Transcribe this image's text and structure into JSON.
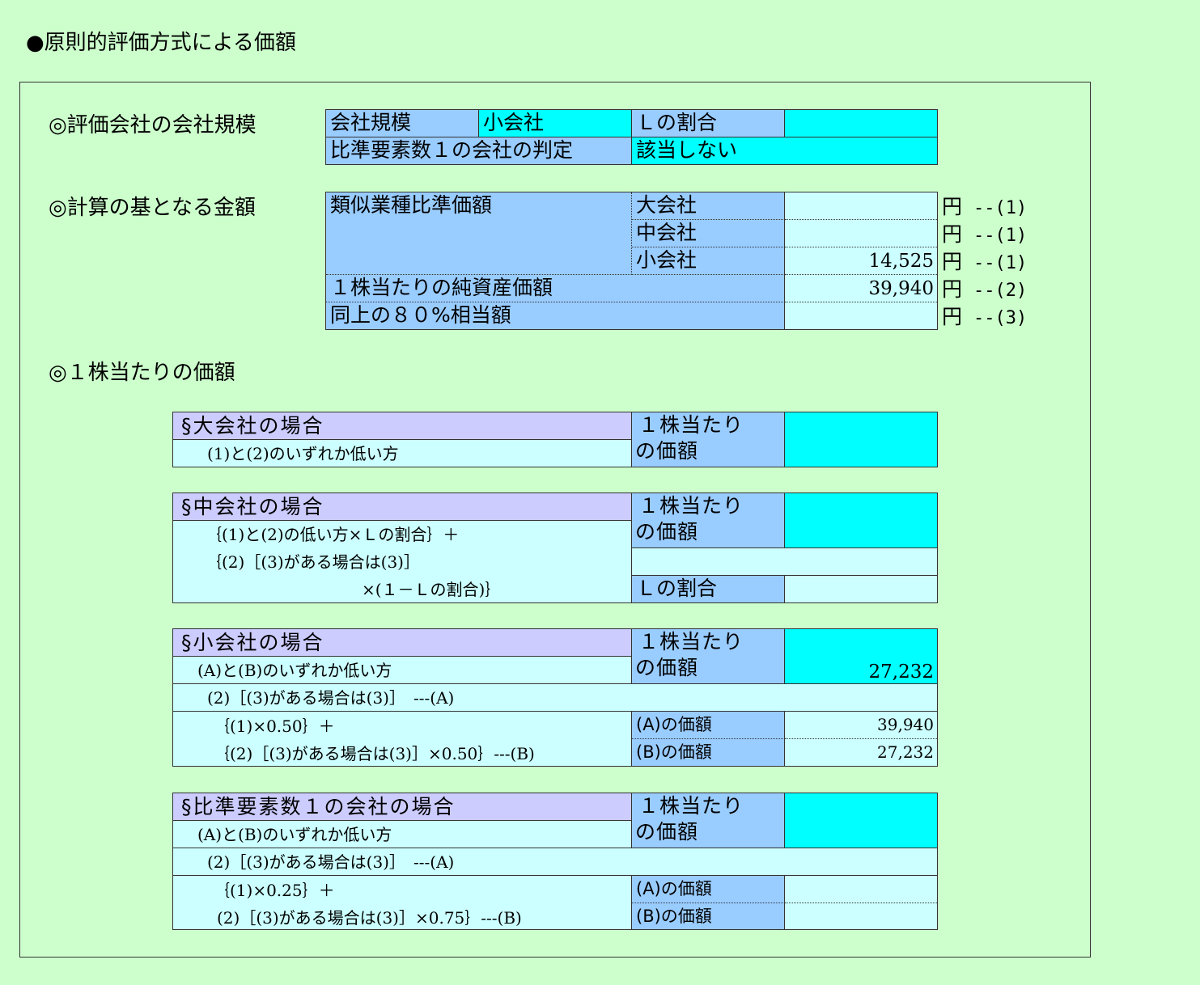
{
  "page_title": "●原則的評価方式による価額",
  "size_section": {
    "heading": "◎評価会社の会社規模",
    "size_label": "会社規模",
    "size_value": "小会社",
    "l_ratio_label": "Ｌの割合",
    "l_ratio_value": "",
    "ratio1_label": "比準要素数１の会社の判定",
    "ratio1_value": "該当しない"
  },
  "base_section": {
    "heading": "◎計算の基となる金額",
    "similar_label": "類似業種比準価額",
    "rows": [
      {
        "label": "大会社",
        "value": "",
        "unit": "円",
        "ref": "--(1)"
      },
      {
        "label": "中会社",
        "value": "",
        "unit": "円",
        "ref": "--(1)"
      },
      {
        "label": "小会社",
        "value": "14,525",
        "unit": "円",
        "ref": "--(1)"
      }
    ],
    "net_asset_label": "１株当たりの純資産価額",
    "net_asset_value": "39,940",
    "net_asset_unit": "円",
    "net_asset_ref": "--(2)",
    "eighty_label": "同上の８０%相当額",
    "eighty_value": "",
    "eighty_unit": "円",
    "eighty_ref": "--(3)"
  },
  "per_share_section": {
    "heading": "◎１株当たりの価額",
    "large": {
      "title": "§大会社の場合",
      "formula": "(1)と(2)のいずれか低い方",
      "price_label_1": "１株当たり",
      "price_label_2": "の価額",
      "price_value": ""
    },
    "medium": {
      "title": "§中会社の場合",
      "formula_1": "｛(1)と(2)の低い方×Ｌの割合｝＋",
      "formula_2": "｛(2)［(3)がある場合は(3)］",
      "formula_3": "×(１－Ｌの割合)｝",
      "price_label_1": "１株当たり",
      "price_label_2": "の価額",
      "price_value": "",
      "l_ratio_label": "Ｌの割合",
      "l_ratio_value": ""
    },
    "small": {
      "title": "§小会社の場合",
      "formula_main": "(A)と(B)のいずれか低い方",
      "formula_1": "(2)［(3)がある場合は(3)］　---(A)",
      "formula_2": "｛(1)×0.50｝＋",
      "formula_3": "｛(2)［(3)がある場合は(3)］×0.50｝---(B)",
      "price_label_1": "１株当たり",
      "price_label_2": "の価額",
      "price_value": "27,232",
      "a_label": "(A)の価額",
      "a_value": "39,940",
      "b_label": "(B)の価額",
      "b_value": "27,232"
    },
    "ratio1": {
      "title": "§比準要素数１の会社の場合",
      "formula_main": "(A)と(B)のいずれか低い方",
      "formula_1": "(2)［(3)がある場合は(3)］　---(A)",
      "formula_2": "｛(1)×0.25｝＋",
      "formula_3": "(2)［(3)がある場合は(3)］×0.75｝---(B)",
      "price_label_1": "１株当たり",
      "price_label_2": "の価額",
      "price_value": "",
      "a_label": "(A)の価額",
      "a_value": "",
      "b_label": "(B)の価額",
      "b_value": ""
    }
  }
}
